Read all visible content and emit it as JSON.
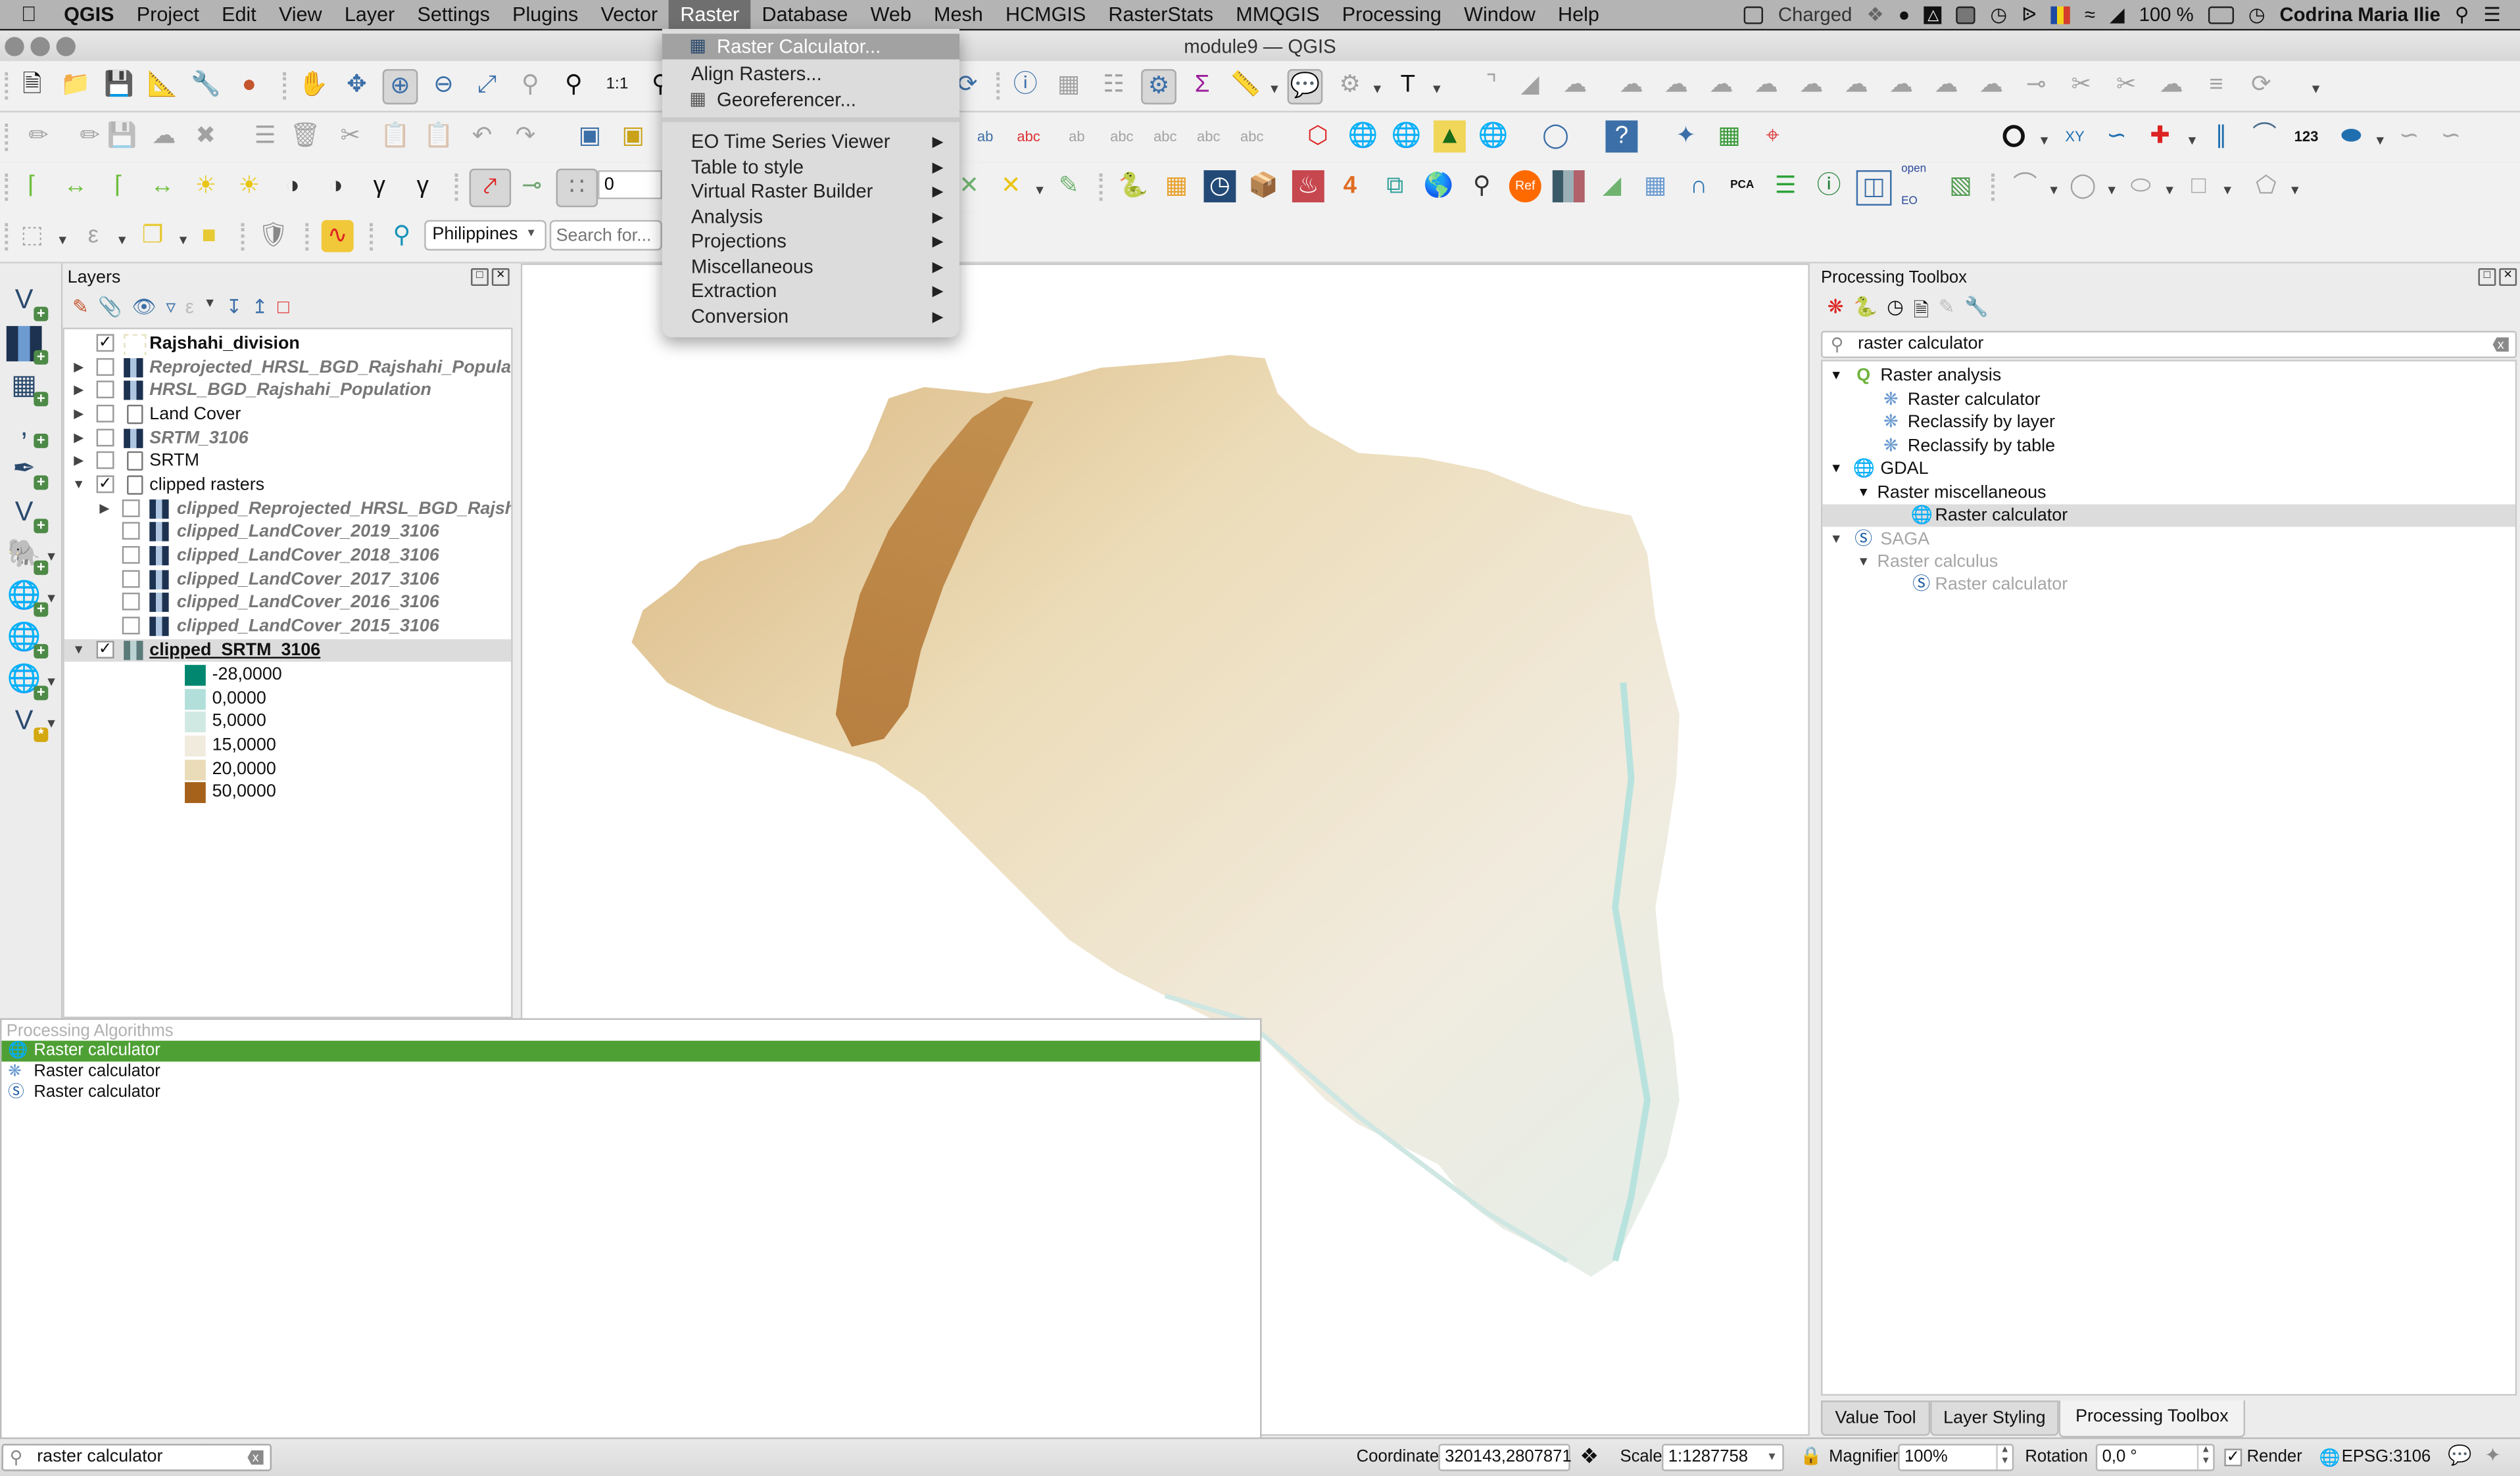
{
  "menubar": {
    "apple": "",
    "app": "QGIS",
    "items": [
      "Project",
      "Edit",
      "View",
      "Layer",
      "Settings",
      "Plugins",
      "Vector",
      "Raster",
      "Database",
      "Web",
      "Mesh",
      "HCMGIS",
      "RasterStats",
      "MMQGIS",
      "Processing",
      "Window",
      "Help"
    ],
    "active": "Raster",
    "status": {
      "battery_label": "Charged",
      "battery_percent": "100 %",
      "user": "Codrina Maria Ilie"
    }
  },
  "window": {
    "title": "module9 — QGIS"
  },
  "raster_menu": {
    "items": [
      {
        "label": "Raster Calculator...",
        "icon": "raster-calculator-icon",
        "highlighted": true,
        "submenu": false
      },
      {
        "label": "Align Rasters...",
        "icon": "",
        "submenu": false
      },
      {
        "label": "Georeferencer...",
        "icon": "georeferencer-icon",
        "submenu": false
      },
      {
        "label": "EO Time Series Viewer",
        "submenu": true
      },
      {
        "label": "Table to style",
        "submenu": true
      },
      {
        "label": "Virtual Raster Builder",
        "submenu": true
      },
      {
        "label": "Analysis",
        "submenu": true
      },
      {
        "label": "Projections",
        "submenu": true
      },
      {
        "label": "Miscellaneous",
        "submenu": true
      },
      {
        "label": "Extraction",
        "submenu": true
      },
      {
        "label": "Conversion",
        "submenu": true
      }
    ]
  },
  "toolbar": {
    "snapping_tolerance": "0",
    "locator_country": "Philippines",
    "search_placeholder": "Search for...",
    "numeric_label": "123"
  },
  "layers_panel": {
    "title": "Layers",
    "layers": [
      {
        "name": "Rajshahi_division",
        "checked": true,
        "expandable": false,
        "style": "bold",
        "icon": "polygon",
        "indent": 0
      },
      {
        "name": "Reprojected_HRSL_BGD_Rajshahi_Population",
        "checked": false,
        "expandable": true,
        "style": "italic",
        "icon": "raster",
        "indent": 0
      },
      {
        "name": "HRSL_BGD_Rajshahi_Population",
        "checked": false,
        "expandable": true,
        "style": "italic",
        "icon": "raster",
        "indent": 0
      },
      {
        "name": "Land Cover",
        "checked": false,
        "expandable": true,
        "style": "normal",
        "icon": "group",
        "indent": 0
      },
      {
        "name": "SRTM_3106",
        "checked": false,
        "expandable": true,
        "style": "italic",
        "icon": "raster",
        "indent": 0
      },
      {
        "name": "SRTM",
        "checked": false,
        "expandable": true,
        "style": "normal",
        "icon": "group",
        "indent": 0
      },
      {
        "name": "clipped rasters",
        "checked": true,
        "expanded": true,
        "expandable": true,
        "style": "normal",
        "icon": "group",
        "indent": 0
      },
      {
        "name": "clipped_Reprojected_HRSL_BGD_Rajshahi_Population",
        "checked": false,
        "expandable": true,
        "style": "italic",
        "icon": "raster",
        "indent": 1
      },
      {
        "name": "clipped_LandCover_2019_3106",
        "checked": false,
        "expandable": false,
        "style": "italic",
        "icon": "raster",
        "indent": 1
      },
      {
        "name": "clipped_LandCover_2018_3106",
        "checked": false,
        "expandable": false,
        "style": "italic",
        "icon": "raster",
        "indent": 1
      },
      {
        "name": "clipped_LandCover_2017_3106",
        "checked": false,
        "expandable": false,
        "style": "italic",
        "icon": "raster",
        "indent": 1
      },
      {
        "name": "clipped_LandCover_2016_3106",
        "checked": false,
        "expandable": false,
        "style": "italic",
        "icon": "raster",
        "indent": 1
      },
      {
        "name": "clipped_LandCover_2015_3106",
        "checked": false,
        "expandable": false,
        "style": "italic",
        "icon": "raster",
        "indent": 1
      },
      {
        "name": "clipped_SRTM_3106",
        "checked": true,
        "expanded": true,
        "expandable": true,
        "style": "selected",
        "icon": "raster",
        "indent": 0
      }
    ],
    "legend": [
      {
        "value": "-28,0000",
        "color": "#01866f"
      },
      {
        "value": "0,0000",
        "color": "#b2dfd9"
      },
      {
        "value": "5,0000",
        "color": "#d1e9e3"
      },
      {
        "value": "15,0000",
        "color": "#f1ebde"
      },
      {
        "value": "20,0000",
        "color": "#ebdcb9"
      },
      {
        "value": "50,0000",
        "color": "#a6611a"
      }
    ]
  },
  "locator_results": {
    "header": "Processing Algorithms",
    "items": [
      {
        "label": "Raster calculator",
        "provider": "gdal",
        "highlighted": true
      },
      {
        "label": "Raster calculator",
        "provider": "qgis",
        "highlighted": false
      },
      {
        "label": "Raster calculator",
        "provider": "saga",
        "highlighted": false
      }
    ]
  },
  "processing_toolbox": {
    "title": "Processing Toolbox",
    "search_value": "raster calculator",
    "tree": [
      {
        "label": "Raster analysis",
        "level": 0,
        "expanded": true,
        "icon": "qgis-icon"
      },
      {
        "label": "Raster calculator",
        "level": 1,
        "icon": "gear-icon"
      },
      {
        "label": "Reclassify by layer",
        "level": 1,
        "icon": "gear-icon"
      },
      {
        "label": "Reclassify by table",
        "level": 1,
        "icon": "gear-icon"
      },
      {
        "label": "GDAL",
        "level": 0,
        "expanded": true,
        "icon": "gdal-icon"
      },
      {
        "label": "Raster miscellaneous",
        "level": 1,
        "expanded": true,
        "icon": ""
      },
      {
        "label": "Raster calculator",
        "level": 2,
        "icon": "gdal-icon",
        "selected": true
      },
      {
        "label": "SAGA",
        "level": 0,
        "expanded": true,
        "icon": "saga-icon",
        "dim": true
      },
      {
        "label": "Raster calculus",
        "level": 1,
        "expanded": true,
        "icon": "",
        "dim": true
      },
      {
        "label": "Raster calculator",
        "level": 2,
        "icon": "saga-icon",
        "dim": true
      }
    ],
    "tabs": [
      "Value Tool",
      "Layer Styling",
      "Processing Toolbox"
    ],
    "active_tab": "Processing Toolbox"
  },
  "statusbar": {
    "locator_value": "raster calculator",
    "coordinate_label": "Coordinate",
    "coordinate_value": "320143,2807871",
    "scale_label": "Scale",
    "scale_value": "1:1287758",
    "magnifier_label": "Magnifier",
    "magnifier_value": "100%",
    "rotation_label": "Rotation",
    "rotation_value": "0,0 °",
    "render_label": "Render",
    "render_checked": true,
    "crs": "EPSG:3106"
  },
  "colors": {
    "highlight_green": "#4ea035",
    "menu_highlight": "#a2a2a2",
    "elevation_low": "#01866f",
    "elevation_high": "#a6611a"
  }
}
